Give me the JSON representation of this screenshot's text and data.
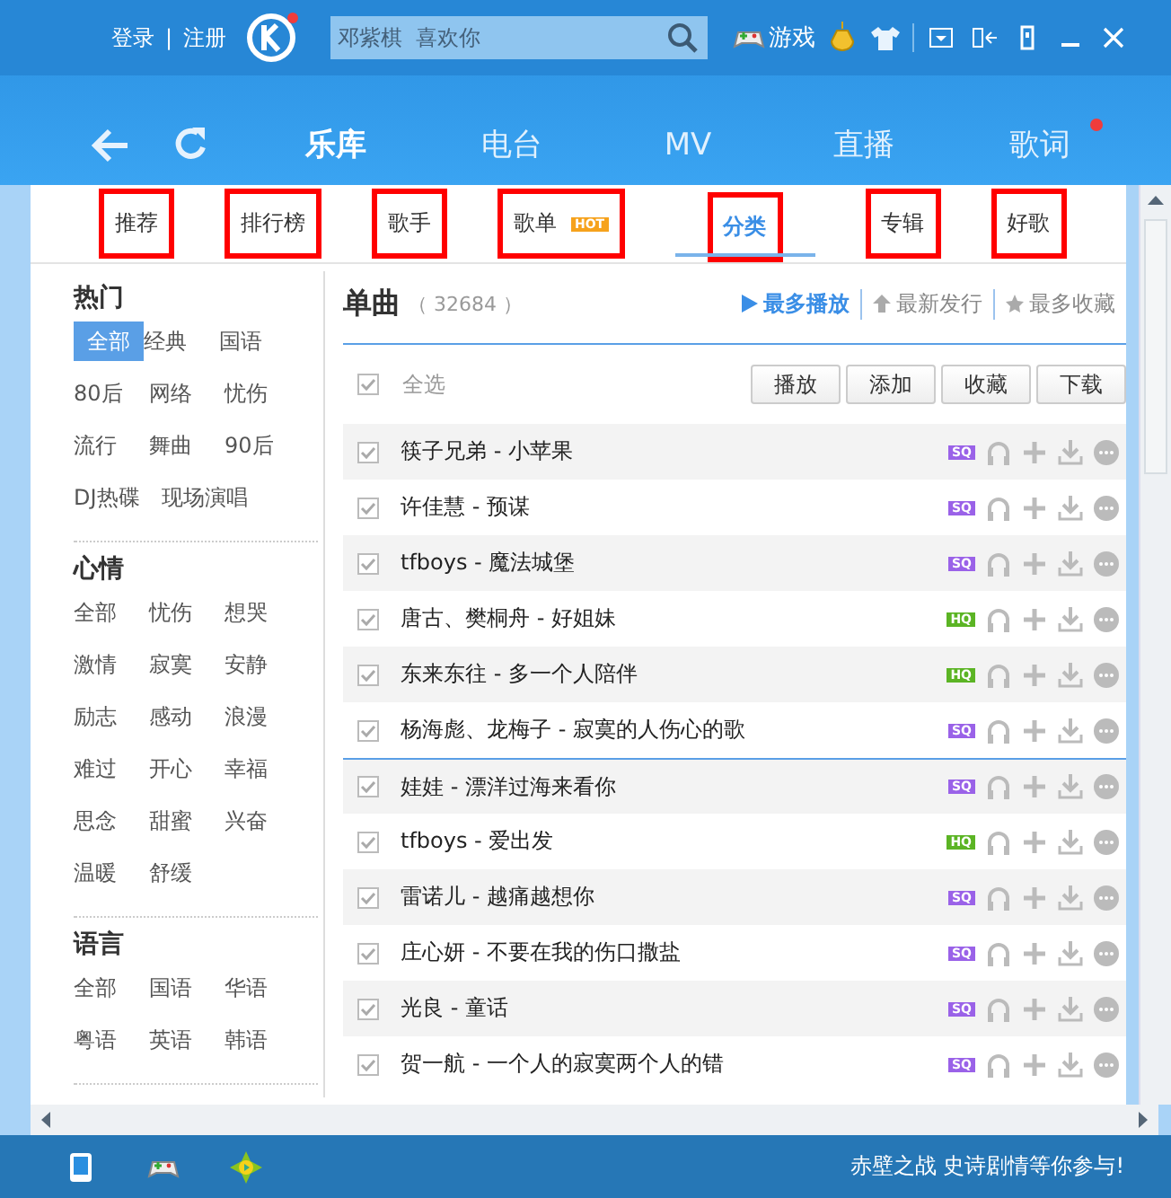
{
  "account": {
    "login": "登录",
    "separator": "|",
    "register": "注册"
  },
  "search": {
    "placeholder": "邓紫棋  喜欢你"
  },
  "games": {
    "label": "游戏"
  },
  "nav": [
    {
      "label": "乐库",
      "selected": true,
      "dot": false
    },
    {
      "label": "电台",
      "selected": false,
      "dot": false
    },
    {
      "label": "MV",
      "selected": false,
      "dot": false
    },
    {
      "label": "直播",
      "selected": false,
      "dot": false
    },
    {
      "label": "歌词",
      "selected": false,
      "dot": true
    }
  ],
  "subtabs": [
    {
      "label": "推荐",
      "selected": false,
      "annotated": true
    },
    {
      "label": "排行榜",
      "selected": false,
      "annotated": true
    },
    {
      "label": "歌手",
      "selected": false,
      "annotated": true
    },
    {
      "label": "歌单",
      "badge": "HOT",
      "selected": false,
      "annotated": true
    },
    {
      "label": "分类",
      "selected": true,
      "annotated": true
    },
    {
      "label": "专辑",
      "selected": false,
      "annotated": true
    },
    {
      "label": "好歌",
      "selected": false,
      "annotated": true
    }
  ],
  "sidebar": [
    {
      "title": "热门",
      "items": [
        {
          "label": "全部",
          "selected": true
        },
        {
          "label": "经典",
          "selected": false
        },
        {
          "label": "国语",
          "selected": false
        },
        {
          "label": "80后",
          "selected": false
        },
        {
          "label": "网络",
          "selected": false
        },
        {
          "label": "忧伤",
          "selected": false
        },
        {
          "label": "流行",
          "selected": false
        },
        {
          "label": "舞曲",
          "selected": false
        },
        {
          "label": "90后",
          "selected": false
        },
        {
          "label": "DJ热碟",
          "selected": false
        },
        {
          "label": "现场演唱",
          "selected": false
        }
      ]
    },
    {
      "title": "心情",
      "items": [
        {
          "label": "全部",
          "selected": false
        },
        {
          "label": "忧伤",
          "selected": false
        },
        {
          "label": "想哭",
          "selected": false
        },
        {
          "label": "激情",
          "selected": false
        },
        {
          "label": "寂寞",
          "selected": false
        },
        {
          "label": "安静",
          "selected": false
        },
        {
          "label": "励志",
          "selected": false
        },
        {
          "label": "感动",
          "selected": false
        },
        {
          "label": "浪漫",
          "selected": false
        },
        {
          "label": "难过",
          "selected": false
        },
        {
          "label": "开心",
          "selected": false
        },
        {
          "label": "幸福",
          "selected": false
        },
        {
          "label": "思念",
          "selected": false
        },
        {
          "label": "甜蜜",
          "selected": false
        },
        {
          "label": "兴奋",
          "selected": false
        },
        {
          "label": "温暖",
          "selected": false
        },
        {
          "label": "舒缓",
          "selected": false
        }
      ]
    },
    {
      "title": "语言",
      "items": [
        {
          "label": "全部",
          "selected": false
        },
        {
          "label": "国语",
          "selected": false
        },
        {
          "label": "华语",
          "selected": false
        },
        {
          "label": "粤语",
          "selected": false
        },
        {
          "label": "英语",
          "selected": false
        },
        {
          "label": "韩语",
          "selected": false
        }
      ]
    }
  ],
  "list": {
    "title": "单曲",
    "count": "（ 32684 ）",
    "sorts": [
      {
        "label": "最多播放",
        "kind": "play",
        "selected": true
      },
      {
        "label": "最新发行",
        "kind": "new",
        "selected": false
      },
      {
        "label": "最多收藏",
        "kind": "fav",
        "selected": false
      }
    ],
    "select_all": {
      "label": "全选",
      "checked": true
    },
    "actions": [
      "播放",
      "添加",
      "收藏",
      "下载"
    ],
    "songs": [
      {
        "text": "筷子兄弟  - 小苹果",
        "quality": "SQ",
        "checked": true
      },
      {
        "text": "许佳慧  - 预谋",
        "quality": "SQ",
        "checked": true
      },
      {
        "text": "tfboys - 魔法城堡",
        "quality": "SQ",
        "checked": true
      },
      {
        "text": "唐古、樊桐舟  - 好姐妹",
        "quality": "HQ",
        "checked": true
      },
      {
        "text": "东来东往  - 多一个人陪伴",
        "quality": "HQ",
        "checked": true
      },
      {
        "text": "杨海彪、龙梅子  - 寂寞的人伤心的歌",
        "quality": "SQ",
        "checked": true
      },
      {
        "text": "娃娃  - 漂洋过海来看你",
        "quality": "SQ",
        "checked": true
      },
      {
        "text": "tfboys - 爱出发",
        "quality": "HQ",
        "checked": true
      },
      {
        "text": "雷诺儿  - 越痛越想你",
        "quality": "SQ",
        "checked": true
      },
      {
        "text": "庄心妍  - 不要在我的伤口撒盐",
        "quality": "SQ",
        "checked": true
      },
      {
        "text": "光良  - 童话",
        "quality": "SQ",
        "checked": true
      },
      {
        "text": "贺一航  - 一个人的寂寞两个人的错",
        "quality": "SQ",
        "checked": true
      }
    ]
  },
  "status_bar": {
    "message": "赤壁之战  史诗剧情等你参与!"
  }
}
